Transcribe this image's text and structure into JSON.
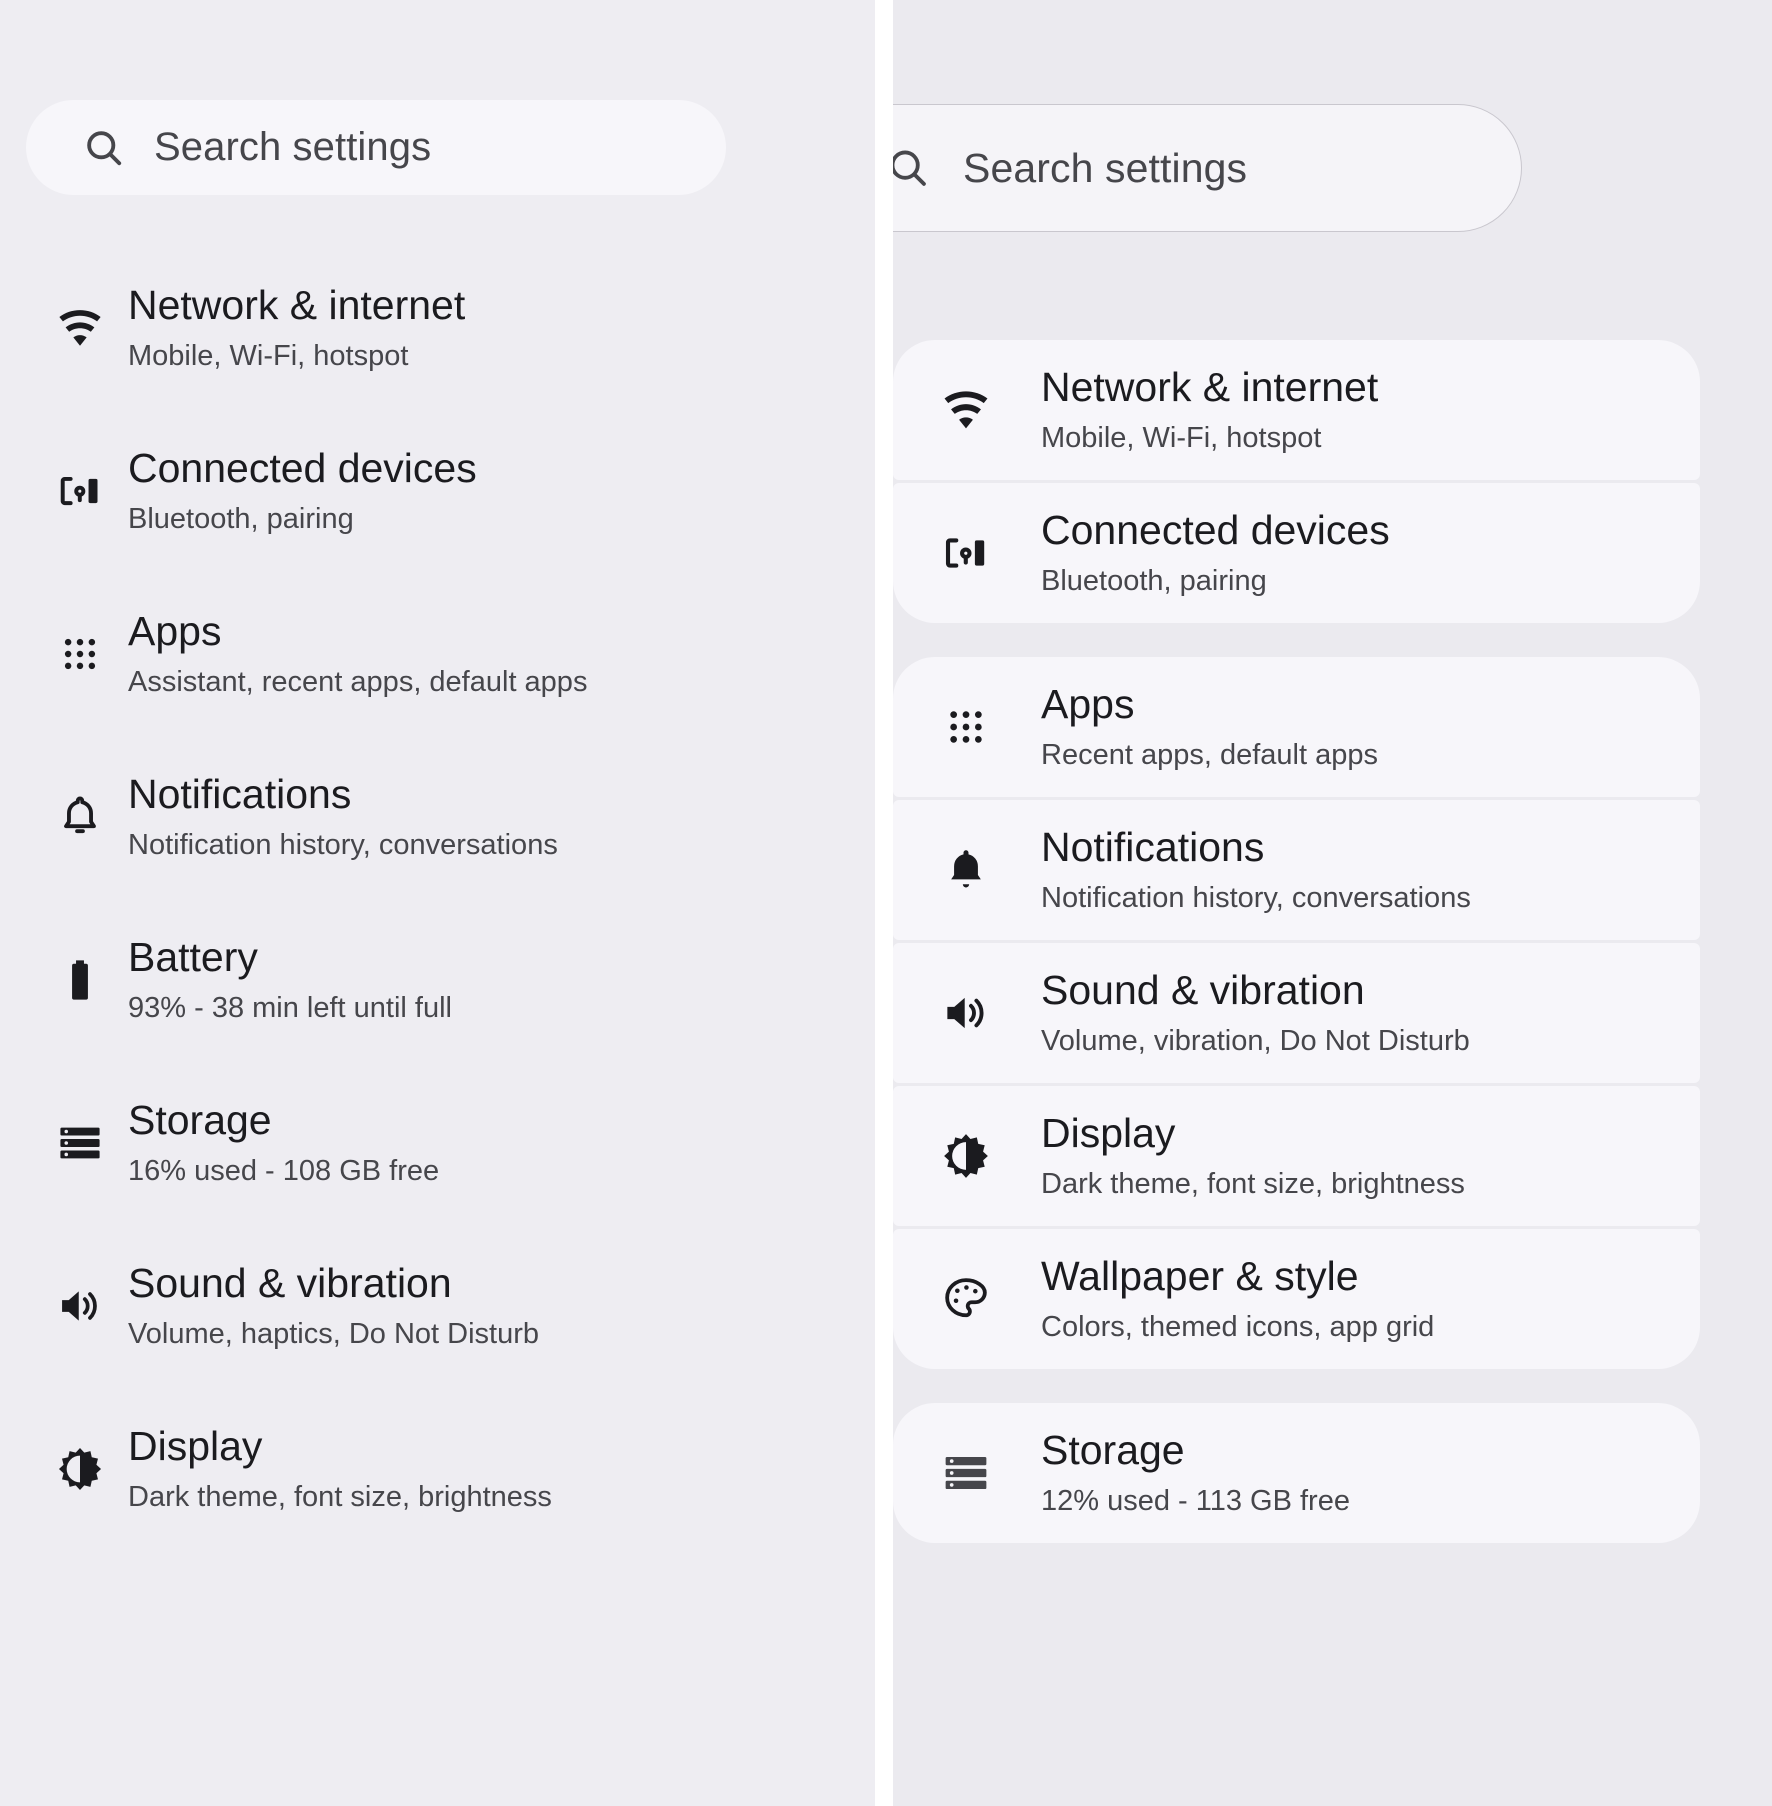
{
  "colors": {
    "left_background": "#eeedf2",
    "right_background": "#ebeaef",
    "card_surface": "#f7f6fa",
    "search_left_surface": "#f7f6fa",
    "search_right_surface": "#f5f4f8",
    "search_right_border": "#c9c7ce",
    "title_text": "#1b1b1f",
    "summary_text": "#46464b",
    "gutter": "#ffffff"
  },
  "left_panel": {
    "search": {
      "icon": "search-icon",
      "placeholder": "Search settings",
      "value": ""
    },
    "items": [
      {
        "icon": "wifi-icon",
        "title": "Network & internet",
        "summary": "Mobile, Wi-Fi, hotspot"
      },
      {
        "icon": "connected-devices-icon",
        "title": "Connected devices",
        "summary": "Bluetooth, pairing"
      },
      {
        "icon": "apps-grid-icon",
        "title": "Apps",
        "summary": "Assistant, recent apps, default apps"
      },
      {
        "icon": "bell-icon",
        "title": "Notifications",
        "summary": "Notification history, conversations"
      },
      {
        "icon": "battery-icon",
        "title": "Battery",
        "summary": "93% - 38 min left until full"
      },
      {
        "icon": "storage-icon",
        "title": "Storage",
        "summary": "16% used - 108 GB free"
      },
      {
        "icon": "volume-icon",
        "title": "Sound & vibration",
        "summary": "Volume, haptics, Do Not Disturb"
      },
      {
        "icon": "brightness-icon",
        "title": "Display",
        "summary": "Dark theme, font size, brightness"
      }
    ]
  },
  "right_panel": {
    "search": {
      "icon": "search-icon",
      "placeholder": "Search settings",
      "value": ""
    },
    "groups": [
      {
        "items": [
          {
            "icon": "wifi-icon",
            "title": "Network & internet",
            "summary": "Mobile, Wi-Fi, hotspot"
          },
          {
            "icon": "connected-devices-icon",
            "title": "Connected devices",
            "summary": "Bluetooth, pairing"
          }
        ]
      },
      {
        "items": [
          {
            "icon": "apps-grid-icon",
            "title": "Apps",
            "summary": "Recent apps, default apps"
          },
          {
            "icon": "bell-icon",
            "title": "Notifications",
            "summary": "Notification history, conversations"
          },
          {
            "icon": "volume-icon",
            "title": "Sound & vibration",
            "summary": "Volume, vibration, Do Not Disturb"
          },
          {
            "icon": "brightness-icon",
            "title": "Display",
            "summary": "Dark theme, font size, brightness"
          },
          {
            "icon": "palette-icon",
            "title": "Wallpaper & style",
            "summary": "Colors, themed icons, app grid"
          }
        ]
      },
      {
        "items": [
          {
            "icon": "storage-icon",
            "title": "Storage",
            "summary": "12% used - 113 GB free"
          }
        ]
      }
    ]
  }
}
